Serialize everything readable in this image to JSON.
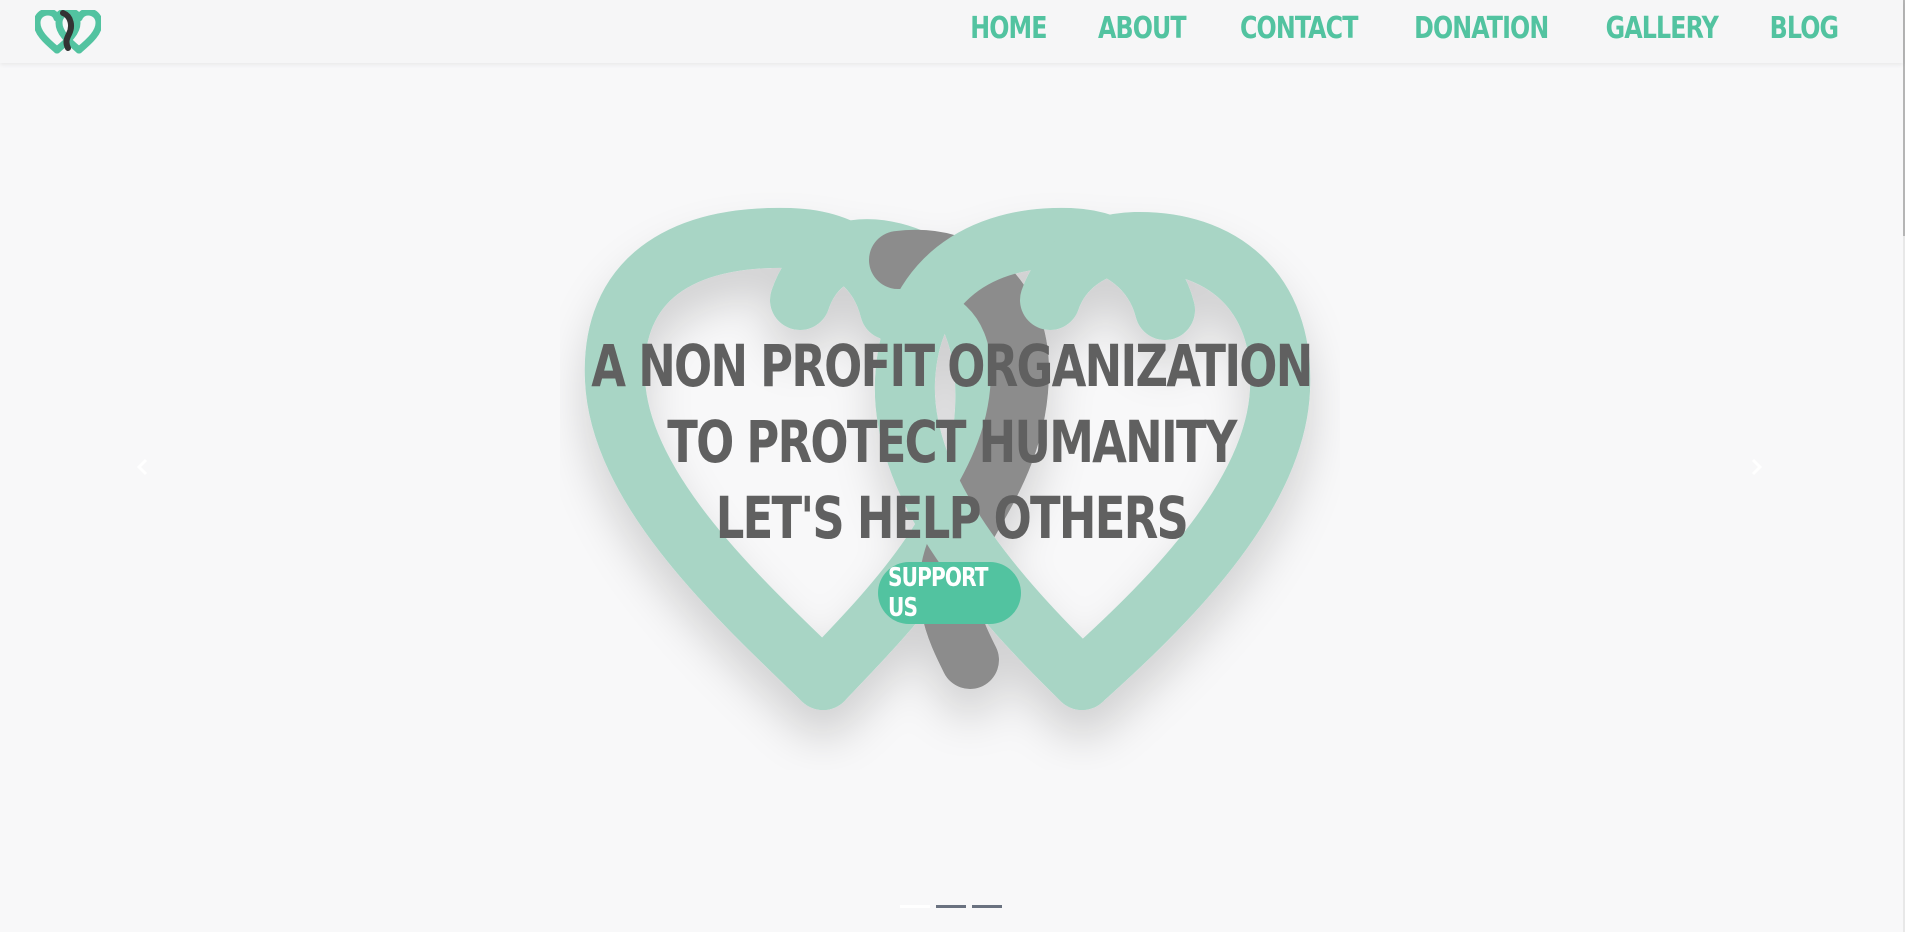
{
  "brand": {
    "logo_icon": "double-heart-ribbon-logo",
    "colors": {
      "primary": "#52c3a0",
      "heart": "#a8d5c5",
      "ribbon": "#8c8c8c",
      "text": "#606060"
    }
  },
  "nav": {
    "items": [
      {
        "label": "HOME"
      },
      {
        "label": "ABOUT"
      },
      {
        "label": "CONTACT"
      },
      {
        "label": "DONATION"
      },
      {
        "label": "GALLERY"
      },
      {
        "label": "BLOG"
      }
    ]
  },
  "hero": {
    "line1": "A NON PROFIT ORGANIZATION",
    "line2": "TO PROTECT HUMANITY",
    "line3": "LET'S HELP OTHERS",
    "cta_label": "SUPPORT US",
    "slide_count": 3,
    "active_slide": 1
  }
}
